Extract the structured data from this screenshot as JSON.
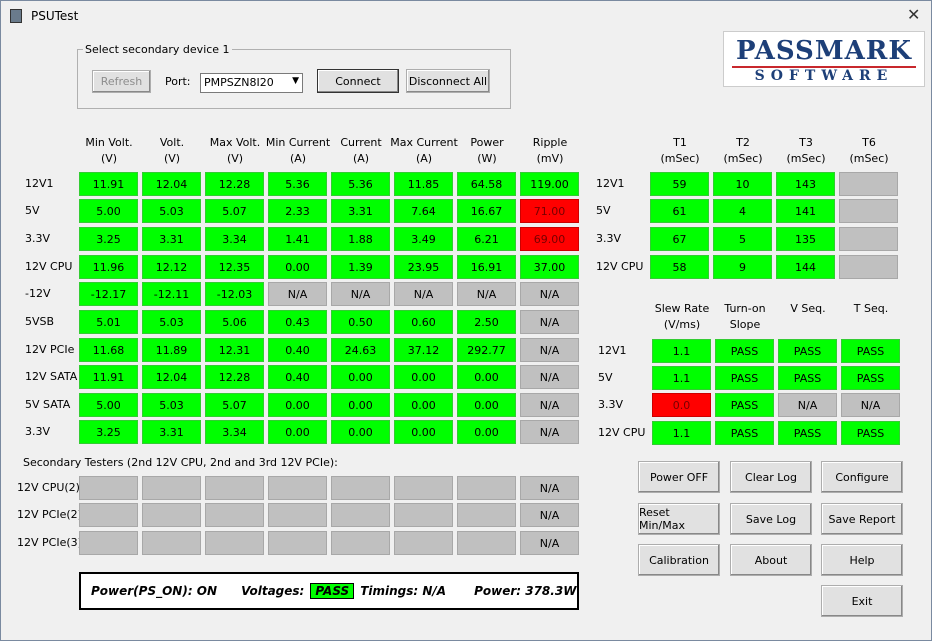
{
  "window": {
    "title": "PSUTest",
    "close": "✕"
  },
  "device": {
    "group_label": "Select secondary device 1",
    "refresh": "Refresh",
    "port_label": "Port:",
    "port_value": "PMPSZN8I20",
    "connect": "Connect",
    "disconnect_all": "Disconnect All"
  },
  "logo": {
    "line1": "PASSMARK",
    "line2": "SOFTWARE"
  },
  "main_table": {
    "headers": [
      [
        "Min Volt.",
        "(V)"
      ],
      [
        "Volt.",
        "(V)"
      ],
      [
        "Max Volt.",
        "(V)"
      ],
      [
        "Min Current",
        "(A)"
      ],
      [
        "Current",
        "(A)"
      ],
      [
        "Max Current",
        "(A)"
      ],
      [
        "Power",
        "(W)"
      ],
      [
        "Ripple",
        "(mV)"
      ]
    ],
    "rows": [
      {
        "label": "12V1",
        "values": [
          "11.91",
          "12.04",
          "12.28",
          "5.36",
          "5.36",
          "11.85",
          "64.58",
          "119.00"
        ],
        "status": "gggggggg"
      },
      {
        "label": "5V",
        "values": [
          "5.00",
          "5.03",
          "5.07",
          "2.33",
          "3.31",
          "7.64",
          "16.67",
          "71.00"
        ],
        "status": "gggggggr"
      },
      {
        "label": "3.3V",
        "values": [
          "3.25",
          "3.31",
          "3.34",
          "1.41",
          "1.88",
          "3.49",
          "6.21",
          "69.00"
        ],
        "status": "gggggggr"
      },
      {
        "label": "12V CPU",
        "values": [
          "11.96",
          "12.12",
          "12.35",
          "0.00",
          "1.39",
          "23.95",
          "16.91",
          "37.00"
        ],
        "status": "gggggggg"
      },
      {
        "label": "-12V",
        "values": [
          "-12.17",
          "-12.11",
          "-12.03",
          "N/A",
          "N/A",
          "N/A",
          "N/A",
          "N/A"
        ],
        "status": "gggnnnnn"
      },
      {
        "label": "5VSB",
        "values": [
          "5.01",
          "5.03",
          "5.06",
          "0.43",
          "0.50",
          "0.60",
          "2.50",
          "N/A"
        ],
        "status": "gggggggn"
      },
      {
        "label": "12V PCIe",
        "values": [
          "11.68",
          "11.89",
          "12.31",
          "0.40",
          "24.63",
          "37.12",
          "292.77",
          "N/A"
        ],
        "status": "gggggggn"
      },
      {
        "label": "12V SATA",
        "values": [
          "11.91",
          "12.04",
          "12.28",
          "0.40",
          "0.00",
          "0.00",
          "0.00",
          "N/A"
        ],
        "status": "gggggggn"
      },
      {
        "label": "5V SATA",
        "values": [
          "5.00",
          "5.03",
          "5.07",
          "0.00",
          "0.00",
          "0.00",
          "0.00",
          "N/A"
        ],
        "status": "gggggggn"
      },
      {
        "label": "3.3V",
        "values": [
          "3.25",
          "3.31",
          "3.34",
          "0.00",
          "0.00",
          "0.00",
          "0.00",
          "N/A"
        ],
        "status": "gggggggn"
      }
    ]
  },
  "secondary": {
    "label": "Secondary Testers (2nd 12V CPU, 2nd and 3rd 12V PCIe):",
    "rows": [
      {
        "label": "12V CPU(2)",
        "values": [
          "",
          "",
          "",
          "",
          "",
          "",
          "",
          "N/A"
        ],
        "status": "nnnnnnnn"
      },
      {
        "label": "12V PCIe(2)",
        "values": [
          "",
          "",
          "",
          "",
          "",
          "",
          "",
          "N/A"
        ],
        "status": "nnnnnnnn"
      },
      {
        "label": "12V PCIe(3)",
        "values": [
          "",
          "",
          "",
          "",
          "",
          "",
          "",
          "N/A"
        ],
        "status": "nnnnnnnn"
      }
    ]
  },
  "timing_table": {
    "headers": [
      [
        "T1",
        "(mSec)"
      ],
      [
        "T2",
        "(mSec)"
      ],
      [
        "T3",
        "(mSec)"
      ],
      [
        "T6",
        "(mSec)"
      ]
    ],
    "rows": [
      {
        "label": "12V1",
        "values": [
          "59",
          "10",
          "143",
          ""
        ],
        "status": "gggn"
      },
      {
        "label": "5V",
        "values": [
          "61",
          "4",
          "141",
          ""
        ],
        "status": "gggn"
      },
      {
        "label": "3.3V",
        "values": [
          "67",
          "5",
          "135",
          ""
        ],
        "status": "gggn"
      },
      {
        "label": "12V CPU",
        "values": [
          "58",
          "9",
          "144",
          ""
        ],
        "status": "gggn"
      }
    ]
  },
  "slew_table": {
    "headers": [
      [
        "Slew Rate",
        "(V/ms)"
      ],
      [
        "Turn-on",
        "Slope"
      ],
      [
        "V Seq.",
        ""
      ],
      [
        "T Seq.",
        ""
      ]
    ],
    "rows": [
      {
        "label": "12V1",
        "values": [
          "1.1",
          "PASS",
          "PASS",
          "PASS"
        ],
        "status": "gggg"
      },
      {
        "label": "5V",
        "values": [
          "1.1",
          "PASS",
          "PASS",
          "PASS"
        ],
        "status": "gggg"
      },
      {
        "label": "3.3V",
        "values": [
          "0.0",
          "PASS",
          "N/A",
          "N/A"
        ],
        "status": "rgnn"
      },
      {
        "label": "12V CPU",
        "values": [
          "1.1",
          "PASS",
          "PASS",
          "PASS"
        ],
        "status": "gggg"
      }
    ]
  },
  "buttons": {
    "power_off": "Power OFF",
    "clear_log": "Clear Log",
    "configure": "Configure",
    "reset": "Reset Min/Max",
    "save_log": "Save Log",
    "save_report": "Save Report",
    "calibration": "Calibration",
    "about": "About",
    "help": "Help",
    "exit": "Exit"
  },
  "status": {
    "ps_on": "Power(PS_ON): ON",
    "voltages_label": "Voltages:",
    "voltages_value": "PASS",
    "timings": "Timings: N/A",
    "power": "Power: 378.3W"
  },
  "colors": {
    "pass": "#00ff00",
    "fail": "#ff0000",
    "na": "#c0c0c0"
  }
}
